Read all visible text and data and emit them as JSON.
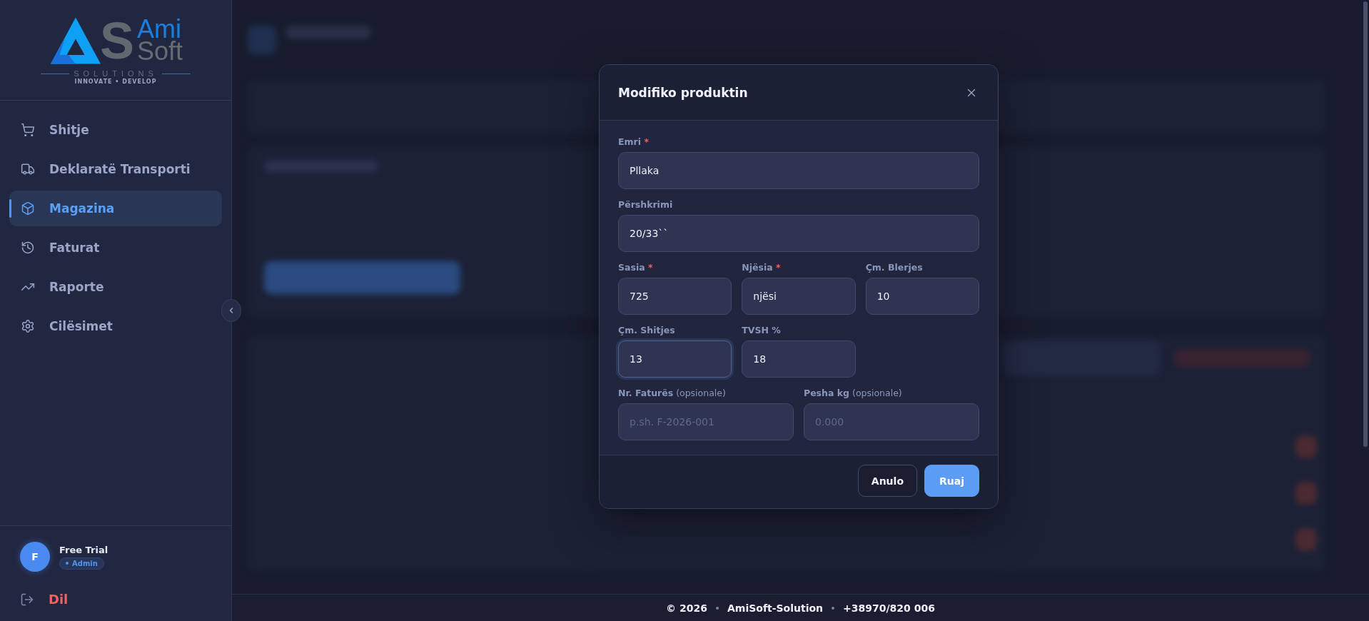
{
  "sidebar": {
    "logo": {
      "mark": "S",
      "word_top": "Ami",
      "word_bottom": "Soft",
      "tagline": "SOLUTIONS",
      "motto": "INNOVATE • DEVELOP"
    },
    "nav": [
      {
        "label": "Shitje",
        "selected": false
      },
      {
        "label": "Deklaratë Transporti",
        "selected": false
      },
      {
        "label": "Magazina",
        "selected": true
      },
      {
        "label": "Faturat",
        "selected": false
      },
      {
        "label": "Raporte",
        "selected": false
      },
      {
        "label": "Cilësimet",
        "selected": false
      }
    ],
    "user": {
      "initial": "F",
      "name": "Free Trial",
      "role": "Admin"
    },
    "logout": {
      "label": "Dil"
    }
  },
  "modal": {
    "title": "Modifiko produktin",
    "fields": [
      {
        "kind": "full",
        "label": "Emri",
        "required_mark": "*",
        "value": "Pllaka",
        "focused": false
      },
      {
        "kind": "full",
        "label": "Përshkrimi",
        "value": "20/33``",
        "focused": false
      },
      {
        "kind": "short",
        "label": "Sasia",
        "required_mark": "*",
        "value": "725",
        "focused": false
      },
      {
        "kind": "short",
        "label": "Njësia",
        "required_mark": "*",
        "value": "njësi",
        "focused": false
      },
      {
        "kind": "short",
        "label": "Çm. Blerjes",
        "value": "10",
        "focused": false
      },
      {
        "kind": "short",
        "label": "Çm. Shitjes",
        "value": "13",
        "focused": true
      },
      {
        "kind": "short",
        "label": "TVSH %",
        "value": "18",
        "focused": false
      },
      {
        "kind": "half",
        "label": "Nr. Faturës",
        "note": "(opsionale)",
        "placeholder": "p.sh. F-2026-001",
        "focused": false
      },
      {
        "kind": "half",
        "label": "Pesha kg",
        "note": "(opsionale)",
        "placeholder": "0.000",
        "focused": false
      }
    ],
    "buttons": [
      {
        "label": "Anulo",
        "kind": "secondary"
      },
      {
        "label": "Ruaj",
        "kind": "primary"
      }
    ]
  },
  "footer": {
    "items": [
      "© 2026",
      "AmiSoft-Solution",
      "+38970/820 006"
    ]
  }
}
